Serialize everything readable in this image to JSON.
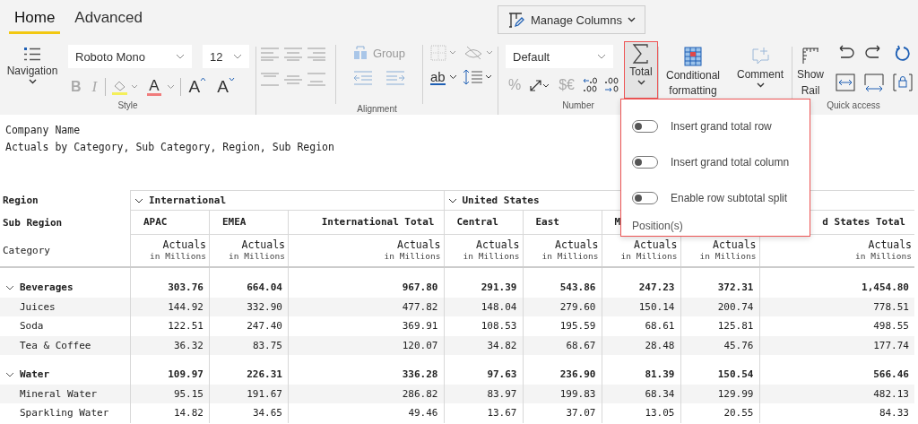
{
  "tabs": [
    {
      "label": "Home",
      "selected": true
    },
    {
      "label": "Advanced",
      "selected": false
    }
  ],
  "manage_columns": {
    "label": "Manage Columns"
  },
  "ribbon": {
    "navigation": {
      "label": "Navigation"
    },
    "style": {
      "font": "Roboto Mono",
      "size": "12",
      "bold": "B",
      "italic": "I",
      "font_color": "A",
      "grow": "A",
      "shrink": "A",
      "label": "Style"
    },
    "alignment": {
      "group": "Group",
      "label": "Alignment"
    },
    "layout": {
      "wrap": "ab"
    },
    "number": {
      "format": "Default",
      "percent": "%",
      "currency": "$€",
      "label": "Number"
    },
    "total": {
      "label": "Total",
      "expanded": true
    },
    "conditional_formatting": {
      "label": "Conditional formatting"
    },
    "comment": {
      "label": "Comment"
    },
    "quick_access": {
      "show_rail": "Show Rail",
      "label": "Quick access"
    }
  },
  "total_menu": {
    "toggles": [
      {
        "label": "Insert grand total row",
        "on": false
      },
      {
        "label": "Insert grand total column",
        "on": false
      },
      {
        "label": "Enable row subtotal split",
        "on": false
      }
    ],
    "section": "Position(s)"
  },
  "report": {
    "company": "Company Name",
    "subtitle": "Actuals by Category, Sub Category, Region, Sub Region"
  },
  "table": {
    "row_headers": [
      "Region",
      "Sub Region",
      "Category"
    ],
    "regions": [
      {
        "name": "International",
        "expanded": true,
        "columns": [
          {
            "kind": "value",
            "sub_region": "APAC",
            "measure": "Actuals",
            "unit": "in Millions"
          },
          {
            "kind": "value",
            "sub_region": "EMEA",
            "measure": "Actuals",
            "unit": "in Millions"
          },
          {
            "kind": "total",
            "sub_region": "International Total",
            "measure": "Actuals",
            "unit": "in Millions"
          }
        ]
      },
      {
        "name": "United States",
        "expanded": true,
        "columns": [
          {
            "kind": "value",
            "sub_region": "Central",
            "measure": "Actuals",
            "unit": "in Millions"
          },
          {
            "kind": "value",
            "sub_region": "East",
            "measure": "Actuals",
            "unit": "in Millions"
          },
          {
            "kind": "value",
            "sub_region": "M",
            "measure": "Actuals",
            "unit": "in Millions"
          },
          {
            "kind": "value",
            "measure": "Actuals",
            "unit": "in Millions"
          },
          {
            "kind": "total",
            "sub_region": "d States Total",
            "measure": "Actuals",
            "unit": "in Millions"
          }
        ]
      }
    ],
    "groups": [
      {
        "category": "Beverages",
        "expanded": true,
        "values": [
          "303.76",
          "664.04",
          "967.80",
          "291.39",
          "543.86",
          "247.23",
          "372.31",
          "1,454.80"
        ],
        "children": [
          {
            "category": "Juices",
            "values": [
              "144.92",
              "332.90",
              "477.82",
              "148.04",
              "279.60",
              "150.14",
              "200.74",
              "778.51"
            ]
          },
          {
            "category": "Soda",
            "values": [
              "122.51",
              "247.40",
              "369.91",
              "108.53",
              "195.59",
              "68.61",
              "125.81",
              "498.55"
            ]
          },
          {
            "category": "Tea & Coffee",
            "values": [
              "36.32",
              "83.75",
              "120.07",
              "34.82",
              "68.67",
              "28.48",
              "45.76",
              "177.74"
            ]
          }
        ]
      },
      {
        "category": "Water",
        "expanded": true,
        "values": [
          "109.97",
          "226.31",
          "336.28",
          "97.63",
          "236.90",
          "81.39",
          "150.54",
          "566.46"
        ],
        "children": [
          {
            "category": "Mineral Water",
            "values": [
              "95.15",
              "191.67",
              "286.82",
              "83.97",
              "199.83",
              "68.34",
              "129.99",
              "482.13"
            ]
          },
          {
            "category": "Sparkling Water",
            "values": [
              "14.82",
              "34.65",
              "49.46",
              "13.67",
              "37.07",
              "13.05",
              "20.55",
              "84.33"
            ]
          }
        ]
      }
    ]
  }
}
